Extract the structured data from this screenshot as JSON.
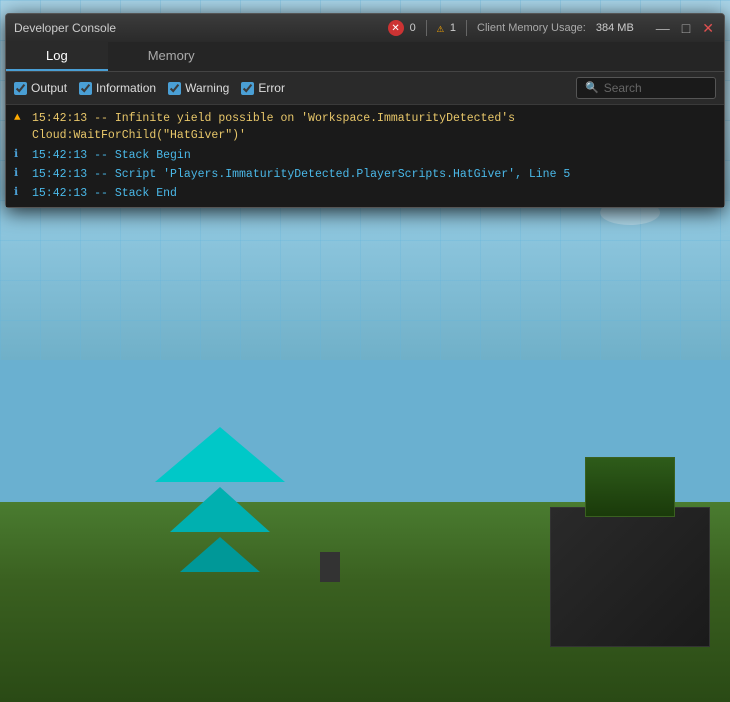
{
  "titleBar": {
    "title": "Developer Console",
    "errorCount": "0",
    "warningCount": "1",
    "memoryLabel": "Client Memory Usage:",
    "memoryValue": "384 MB",
    "minimizeLabel": "—",
    "maximizeLabel": "□",
    "closeLabel": "✕"
  },
  "tabs": [
    {
      "id": "log",
      "label": "Log",
      "active": true
    },
    {
      "id": "memory",
      "label": "Memory",
      "active": false
    }
  ],
  "toolbar": {
    "outputLabel": "Output",
    "informationLabel": "Information",
    "warningLabel": "Warning",
    "errorLabel": "Error",
    "searchPlaceholder": "Search"
  },
  "logLines": [
    {
      "type": "warning",
      "icon": "▲",
      "text": "15:42:13 -- Infinite yield possible on 'Workspace.ImmaturityDetected's Cloud:WaitForChild(\"HatGiver\")'",
      "colorClass": "yellow"
    },
    {
      "type": "info",
      "icon": "ℹ",
      "text": "15:42:13 -- Stack Begin",
      "colorClass": "blue"
    },
    {
      "type": "info",
      "icon": "ℹ",
      "text": "15:42:13 -- Script 'Players.ImmaturityDetected.PlayerScripts.HatGiver', Line 5",
      "colorClass": "blue"
    },
    {
      "type": "info",
      "icon": "ℹ",
      "text": "15:42:13 -- Stack End",
      "colorClass": "blue"
    }
  ]
}
